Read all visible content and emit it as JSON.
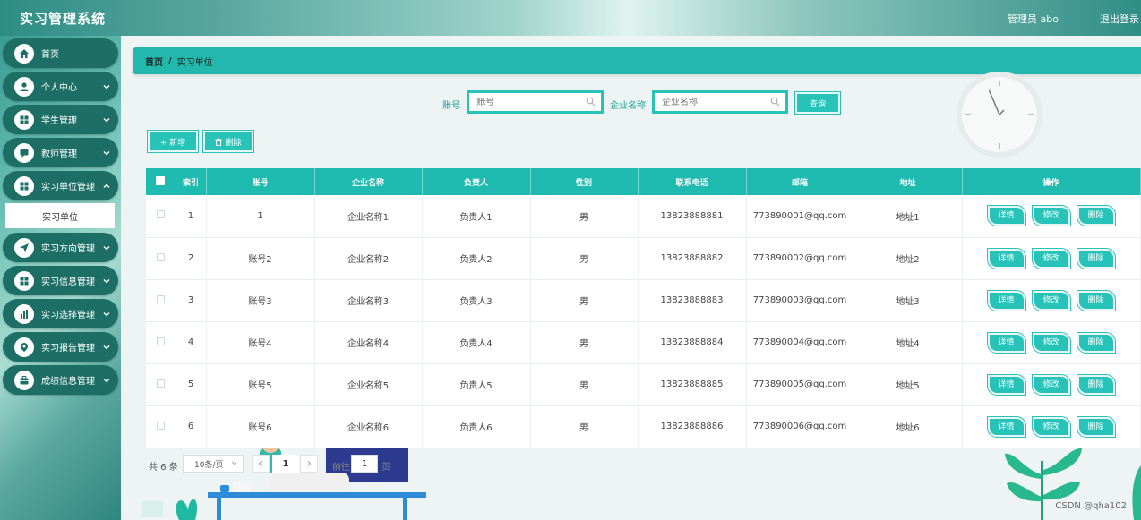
{
  "app": {
    "title": "实习管理系统",
    "admin_label": "管理员 abo",
    "logout": "退出登录"
  },
  "sidebar": {
    "items": [
      {
        "label": "首页",
        "icon": "home-icon"
      },
      {
        "label": "个人中心",
        "icon": "user-icon"
      },
      {
        "label": "学生管理",
        "icon": "grid-icon"
      },
      {
        "label": "教师管理",
        "icon": "chat-icon"
      },
      {
        "label": "实习单位管理",
        "icon": "grid-icon"
      },
      {
        "label": "实习方向管理",
        "icon": "send-icon"
      },
      {
        "label": "实习信息管理",
        "icon": "grid-icon"
      },
      {
        "label": "实习选择管理",
        "icon": "bar-chart-icon"
      },
      {
        "label": "实习报告管理",
        "icon": "location-icon"
      },
      {
        "label": "成绩信息管理",
        "icon": "briefcase-icon"
      }
    ],
    "active_sub": "实习单位"
  },
  "breadcrumb": {
    "home": "首页",
    "current": "实习单位"
  },
  "search": {
    "account_label": "账号",
    "account_placeholder": "账号",
    "company_label": "企业名称",
    "company_placeholder": "企业名称",
    "query_btn": "查询"
  },
  "actions": {
    "add": "+ 新增",
    "delete": "删除"
  },
  "table": {
    "headers": [
      "索引",
      "账号",
      "企业名称",
      "负责人",
      "性别",
      "联系电话",
      "邮箱",
      "地址",
      "操作"
    ],
    "rows": [
      {
        "index": "1",
        "account": "1",
        "company": "企业名称1",
        "manager": "负责人1",
        "gender": "男",
        "phone": "13823888881",
        "email": "773890001@qq.com",
        "address": "地址1"
      },
      {
        "index": "2",
        "account": "账号2",
        "company": "企业名称2",
        "manager": "负责人2",
        "gender": "男",
        "phone": "13823888882",
        "email": "773890002@qq.com",
        "address": "地址2"
      },
      {
        "index": "3",
        "account": "账号3",
        "company": "企业名称3",
        "manager": "负责人3",
        "gender": "男",
        "phone": "13823888883",
        "email": "773890003@qq.com",
        "address": "地址3"
      },
      {
        "index": "4",
        "account": "账号4",
        "company": "企业名称4",
        "manager": "负责人4",
        "gender": "男",
        "phone": "13823888884",
        "email": "773890004@qq.com",
        "address": "地址4"
      },
      {
        "index": "5",
        "account": "账号5",
        "company": "企业名称5",
        "manager": "负责人5",
        "gender": "男",
        "phone": "13823888885",
        "email": "773890005@qq.com",
        "address": "地址5"
      },
      {
        "index": "6",
        "account": "账号6",
        "company": "企业名称6",
        "manager": "负责人6",
        "gender": "男",
        "phone": "13823888886",
        "email": "773890006@qq.com",
        "address": "地址6"
      }
    ],
    "row_buttons": {
      "detail": "详情",
      "edit": "修改",
      "delete": "删除"
    }
  },
  "pager": {
    "total": "共 6 条",
    "page_size": "10条/页",
    "page": "1",
    "goto_label": "前往",
    "goto_value": "1",
    "goto_suffix": "页"
  },
  "watermark": "CSDN @qha102",
  "colors": {
    "accent": "#27c3b8",
    "menu_bg": "#1d6f66"
  }
}
